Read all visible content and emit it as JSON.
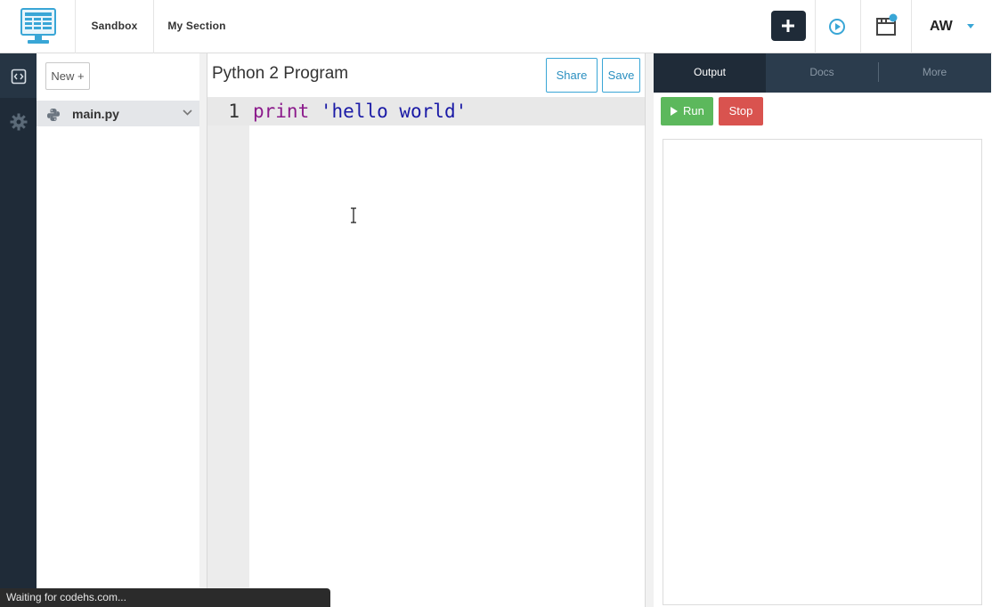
{
  "nav": {
    "links": [
      "Sandbox",
      "My Section"
    ],
    "user_initials": "AW"
  },
  "files": {
    "new_label": "New +",
    "items": [
      {
        "name": "main.py",
        "icon": "python-icon"
      }
    ]
  },
  "editor": {
    "title": "Python 2 Program",
    "share_label": "Share",
    "save_label": "Save",
    "line_number": "1",
    "code": {
      "keyword": "print",
      "string": "'hello world'"
    }
  },
  "output": {
    "tabs": [
      "Output",
      "Docs",
      "More"
    ],
    "active_tab": "Output",
    "run_label": "Run",
    "stop_label": "Stop"
  },
  "status": {
    "text": "Waiting for codehs.com..."
  },
  "colors": {
    "nav_dark": "#1f2b38",
    "accent": "#39a6d6",
    "run_green": "#5cb85c",
    "stop_red": "#d9534f",
    "keyword": "#8b1a8b",
    "string": "#1a1aa6"
  }
}
